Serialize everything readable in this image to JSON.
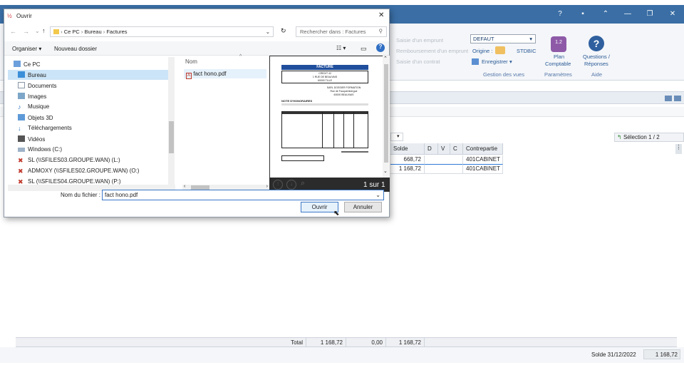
{
  "app": {
    "ribbon": {
      "dim_items": [
        "Saisie d'un emprunt",
        "Remboursement d'un emprunt",
        "Saisie d'un contrat"
      ],
      "defaut_value": "DEFAUT",
      "origine_label": "Origine :",
      "origine_code": "STDBIC",
      "enregistrer_label": "Enregistrer",
      "group_views": "Gestion des vues",
      "plan_label_1": "Plan",
      "plan_label_2": "Comptable",
      "group_params": "Paramètres",
      "qa_label_1": "Questions /",
      "qa_label_2": "Réponses",
      "group_help": "Aide"
    },
    "selection_text": "Sélection 1 / 2",
    "grid": {
      "headers": [
        "Solde",
        "D",
        "V",
        "C",
        "Contrepartie"
      ],
      "rows": [
        {
          "solde": "668,72",
          "contrepartie": "401CABINET"
        },
        {
          "solde": "1 168,72",
          "contrepartie": "401CABINET"
        }
      ]
    },
    "totals": {
      "label": "Total",
      "debit": "1 168,72",
      "credit": "0,00",
      "solde": "1 168,72"
    },
    "status": {
      "label": "Solde 31/12/2022",
      "value": "1 168,72"
    }
  },
  "dialog": {
    "title": "Ouvrir",
    "breadcrumb": [
      "Ce PC",
      "Bureau",
      "Factures"
    ],
    "search_placeholder": "Rechercher dans : Factures",
    "organize": "Organiser",
    "new_folder": "Nouveau dossier",
    "tree": [
      {
        "label": "Ce PC",
        "icon": "pc-icon"
      },
      {
        "label": "Bureau",
        "icon": "desktop-icon",
        "selected": true
      },
      {
        "label": "Documents",
        "icon": "documents-icon"
      },
      {
        "label": "Images",
        "icon": "images-icon"
      },
      {
        "label": "Musique",
        "icon": "music-icon"
      },
      {
        "label": "Objets 3D",
        "icon": "objects3d-icon"
      },
      {
        "label": "Téléchargements",
        "icon": "downloads-icon"
      },
      {
        "label": "Vidéos",
        "icon": "videos-icon"
      },
      {
        "label": "Windows (C:)",
        "icon": "drive-icon"
      },
      {
        "label": "SL (\\\\SFILES03.GROUPE.WAN) (L:)",
        "icon": "network-drive-icon"
      },
      {
        "label": "ADMOXY (\\\\SFILES02.GROUPE.WAN) (O:)",
        "icon": "network-drive-icon"
      },
      {
        "label": "SL (\\\\SFILES04.GROUPE.WAN) (P:)",
        "icon": "network-drive-icon"
      }
    ],
    "column_name": "Nom",
    "files": [
      "fact hono.pdf"
    ],
    "preview": {
      "doc_title": "FACTURE",
      "header_lines": [
        "CREDIT 42",
        "1 RUE DE BEAUVAIS",
        "60000 TILLE"
      ],
      "recipient_lines": [
        "SARL DOSSIER FORMATION",
        "Rue de Fauquembergue",
        "60000 BEAUVAIS"
      ],
      "note_title": "NOTE D'HONORAIRES",
      "page_text": "1 sur 1"
    },
    "filename_label": "Nom du fichier :",
    "filename_value": "fact hono.pdf",
    "open_label": "Ouvrir",
    "cancel_label": "Annuler"
  }
}
